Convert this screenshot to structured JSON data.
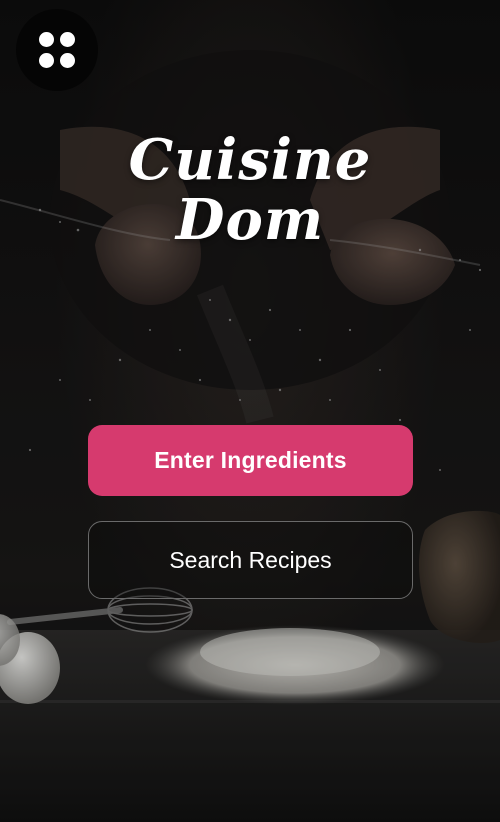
{
  "app": {
    "logo_line1": "Cuisine",
    "logo_line2": "Dom"
  },
  "menu": {
    "icon": "grid-dots-icon"
  },
  "actions": {
    "enter_ingredients_label": "Enter Ingredients",
    "search_recipes_label": "Search Recipes"
  },
  "colors": {
    "accent": "#d63a6e",
    "background": "#0b0b0b",
    "text": "#ffffff",
    "outline_border": "#6a6a6a"
  }
}
